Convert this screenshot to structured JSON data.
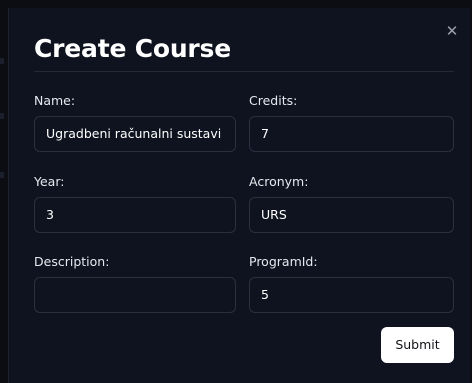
{
  "modal": {
    "title": "Create Course",
    "close_icon": "close-icon",
    "submit_label": "Submit"
  },
  "fields": {
    "name": {
      "label": "Name:",
      "value": "Ugradbeni računalni sustavi"
    },
    "credits": {
      "label": "Credits:",
      "value": "7"
    },
    "year": {
      "label": "Year:",
      "value": "3"
    },
    "acronym": {
      "label": "Acronym:",
      "value": "URS"
    },
    "description": {
      "label": "Description:",
      "value": ""
    },
    "programid": {
      "label": "ProgramId:",
      "value": "5"
    }
  }
}
